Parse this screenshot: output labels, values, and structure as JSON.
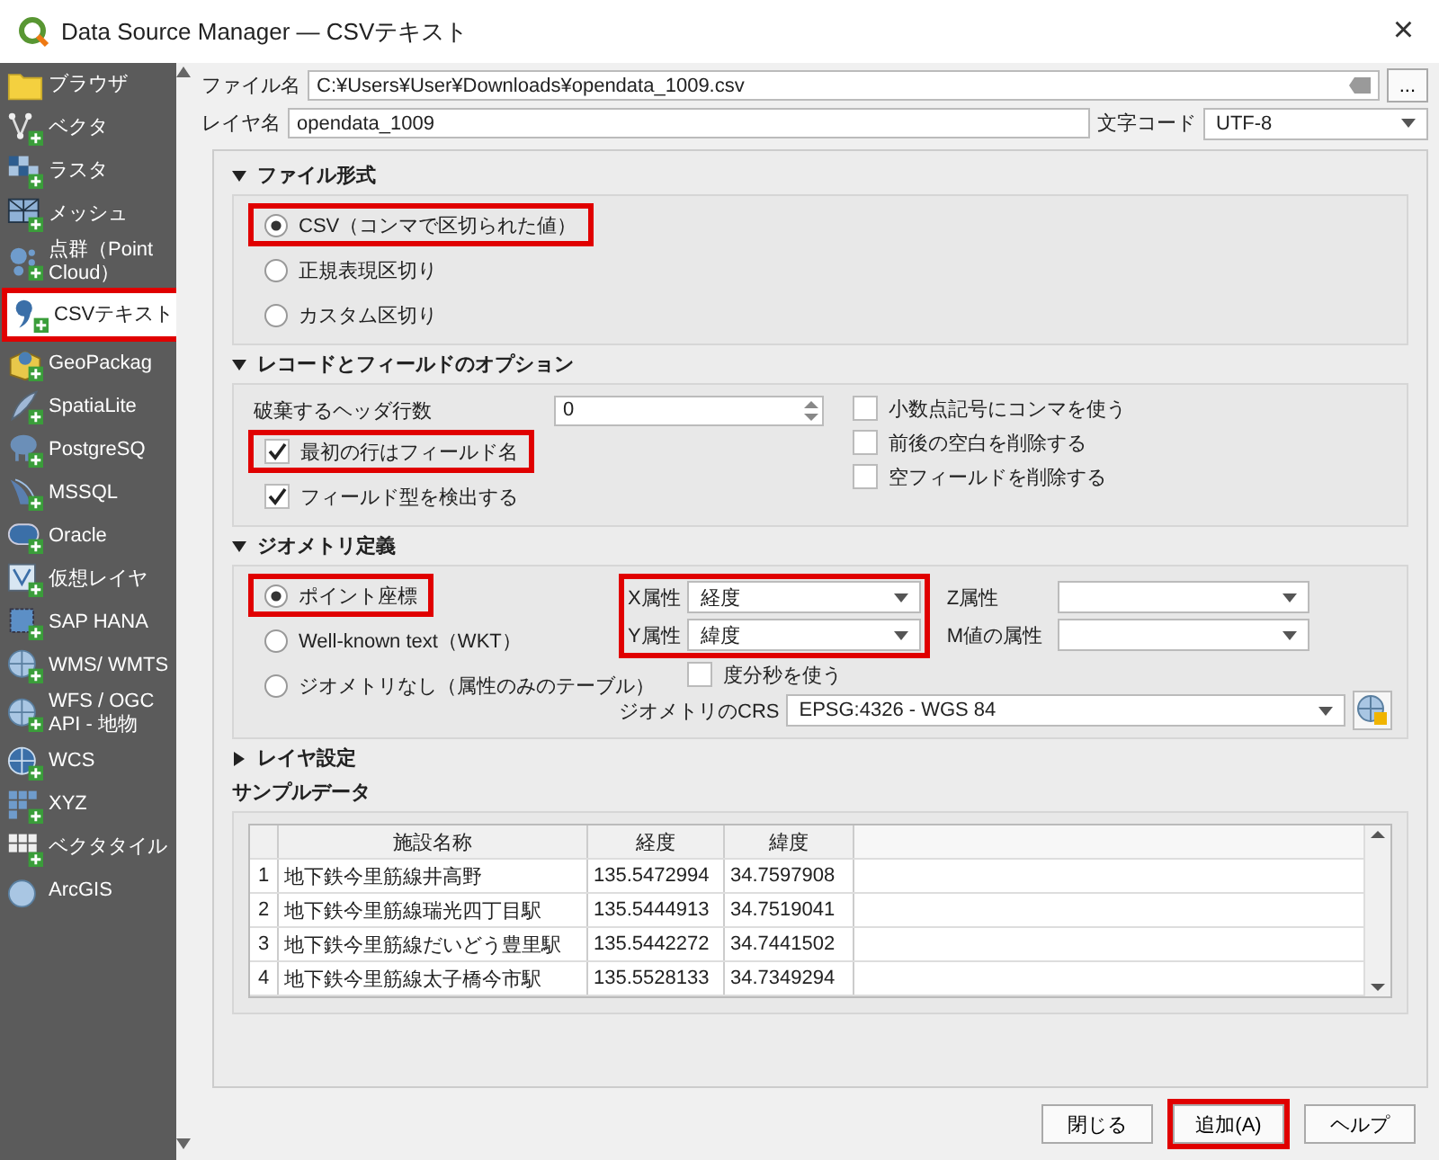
{
  "window": {
    "title": "Data Source Manager — CSVテキスト",
    "close": "×"
  },
  "sidebar": {
    "items": [
      {
        "label": "ブラウザ",
        "selected": false,
        "highlighted": false
      },
      {
        "label": "ベクタ",
        "selected": false,
        "highlighted": false
      },
      {
        "label": "ラスタ",
        "selected": false,
        "highlighted": false
      },
      {
        "label": "メッシュ",
        "selected": false,
        "highlighted": false
      },
      {
        "label": "点群（Point Cloud）",
        "selected": false,
        "highlighted": false
      },
      {
        "label": "CSVテキスト",
        "selected": true,
        "highlighted": true
      },
      {
        "label": "GeoPackag",
        "selected": false,
        "highlighted": false
      },
      {
        "label": "SpatiaLite",
        "selected": false,
        "highlighted": false
      },
      {
        "label": "PostgreSQ",
        "selected": false,
        "highlighted": false
      },
      {
        "label": "MSSQL",
        "selected": false,
        "highlighted": false
      },
      {
        "label": "Oracle",
        "selected": false,
        "highlighted": false
      },
      {
        "label": "仮想レイヤ",
        "selected": false,
        "highlighted": false
      },
      {
        "label": "SAP HANA",
        "selected": false,
        "highlighted": false
      },
      {
        "label": "WMS/ WMTS",
        "selected": false,
        "highlighted": false
      },
      {
        "label": "WFS / OGC API - 地物",
        "selected": false,
        "highlighted": false
      },
      {
        "label": "WCS",
        "selected": false,
        "highlighted": false
      },
      {
        "label": "XYZ",
        "selected": false,
        "highlighted": false
      },
      {
        "label": "ベクタタイル",
        "selected": false,
        "highlighted": false
      },
      {
        "label": "ArcGIS",
        "selected": false,
        "highlighted": false
      }
    ]
  },
  "file": {
    "label": "ファイル名",
    "value": "C:¥Users¥User¥Downloads¥opendata_1009.csv",
    "browse_button": "..."
  },
  "layer": {
    "label": "レイヤ名",
    "value": "opendata_1009"
  },
  "encoding": {
    "label": "文字コード",
    "value": "UTF-8"
  },
  "file_format": {
    "title": "ファイル形式",
    "expanded": true,
    "options": [
      {
        "label": "CSV（コンマで区切られた値）",
        "selected": true,
        "highlighted": true
      },
      {
        "label": "正規表現区切り",
        "selected": false,
        "highlighted": false
      },
      {
        "label": "カスタム区切り",
        "selected": false,
        "highlighted": false
      }
    ]
  },
  "record_options": {
    "title": "レコードとフィールドのオプション",
    "expanded": true,
    "header_lines": {
      "label": "破棄するヘッダ行数",
      "value": "0"
    },
    "left_checks": [
      {
        "label": "最初の行はフィールド名",
        "checked": true,
        "highlighted": true
      },
      {
        "label": "フィールド型を検出する",
        "checked": true,
        "highlighted": false
      }
    ],
    "right_checks": [
      {
        "label": "小数点記号にコンマを使う",
        "checked": false
      },
      {
        "label": "前後の空白を削除する",
        "checked": false
      },
      {
        "label": "空フィールドを削除する",
        "checked": false
      }
    ]
  },
  "geometry": {
    "title": "ジオメトリ定義",
    "expanded": true,
    "options": [
      {
        "label": "ポイント座標",
        "selected": true,
        "highlighted": true
      },
      {
        "label": "Well-known text（WKT）",
        "selected": false,
        "highlighted": false
      },
      {
        "label": "ジオメトリなし（属性のみのテーブル）",
        "selected": false,
        "highlighted": false
      }
    ],
    "xy_highlighted": true,
    "x_field": {
      "label": "X属性",
      "value": "経度"
    },
    "y_field": {
      "label": "Y属性",
      "value": "緯度"
    },
    "z_field": {
      "label": "Z属性"
    },
    "m_field": {
      "label": "M値の属性"
    },
    "dms": {
      "label": "度分秒を使う",
      "checked": false
    },
    "crs": {
      "label": "ジオメトリのCRS",
      "value": "EPSG:4326 - WGS 84"
    }
  },
  "layer_settings": {
    "title": "レイヤ設定",
    "expanded": false
  },
  "sample_data": {
    "title": "サンプルデータ",
    "columns": [
      "施設名称",
      "経度",
      "緯度"
    ],
    "rows": [
      {
        "index": "1",
        "cells": [
          "地下鉄今里筋線井高野",
          "135.5472994",
          "34.7597908"
        ]
      },
      {
        "index": "2",
        "cells": [
          "地下鉄今里筋線瑞光四丁目駅",
          "135.5444913",
          "34.7519041"
        ]
      },
      {
        "index": "3",
        "cells": [
          "地下鉄今里筋線だいどう豊里駅",
          "135.5442272",
          "34.7441502"
        ]
      },
      {
        "index": "4",
        "cells": [
          "地下鉄今里筋線太子橋今市駅",
          "135.5528133",
          "34.7349294"
        ]
      }
    ]
  },
  "buttons": [
    {
      "label": "閉じる",
      "highlighted": false
    },
    {
      "label": "追加(A)",
      "highlighted": true
    },
    {
      "label": "ヘルプ",
      "highlighted": false
    }
  ]
}
